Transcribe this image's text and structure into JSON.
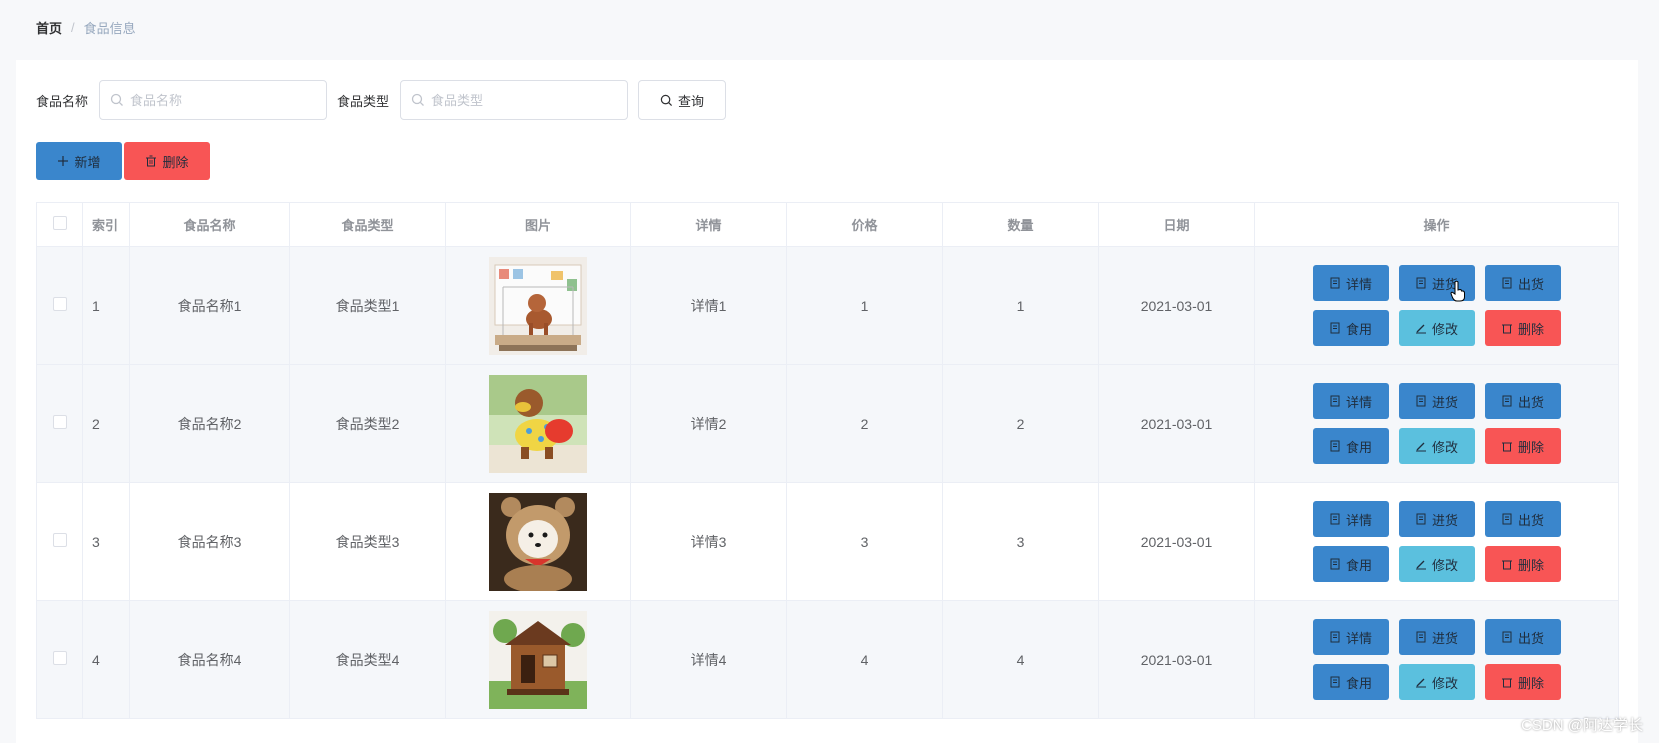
{
  "breadcrumb": {
    "home": "首页",
    "separator": "/",
    "current": "食品信息"
  },
  "search": {
    "name_label": "食品名称",
    "name_placeholder": "食品名称",
    "type_label": "食品类型",
    "type_placeholder": "食品类型",
    "query_label": "查询"
  },
  "toolbar": {
    "add_label": "新增",
    "delete_label": "删除"
  },
  "table": {
    "headers": {
      "index": "索引",
      "name": "食品名称",
      "type": "食品类型",
      "image": "图片",
      "detail": "详情",
      "price": "价格",
      "quantity": "数量",
      "date": "日期",
      "actions": "操作"
    },
    "rows": [
      {
        "index": "1",
        "name": "食品名称1",
        "type": "食品类型1",
        "image": "poodle-in-cage",
        "detail": "详情1",
        "price": "1",
        "quantity": "1",
        "date": "2021-03-01"
      },
      {
        "index": "2",
        "name": "食品名称2",
        "type": "食品类型2",
        "image": "poodle-in-sweater",
        "detail": "详情2",
        "price": "2",
        "quantity": "2",
        "date": "2021-03-01"
      },
      {
        "index": "3",
        "name": "食品名称3",
        "type": "食品类型3",
        "image": "puppy-in-hood",
        "detail": "详情3",
        "price": "3",
        "quantity": "3",
        "date": "2021-03-01"
      },
      {
        "index": "4",
        "name": "食品名称4",
        "type": "食品类型4",
        "image": "wooden-dog-house",
        "detail": "详情4",
        "price": "4",
        "quantity": "4",
        "date": "2021-03-01"
      }
    ],
    "row_actions": {
      "detail": "详情",
      "stock_in": "进货",
      "stock_out": "出货",
      "consume": "食用",
      "edit": "修改",
      "delete": "删除"
    }
  },
  "watermark": "CSDN @阿达学长",
  "colors": {
    "primary": "#3a86cc",
    "info": "#5bc0de",
    "danger": "#f85555",
    "border": "#ebeef5",
    "stripe": "#f5f7fa"
  }
}
